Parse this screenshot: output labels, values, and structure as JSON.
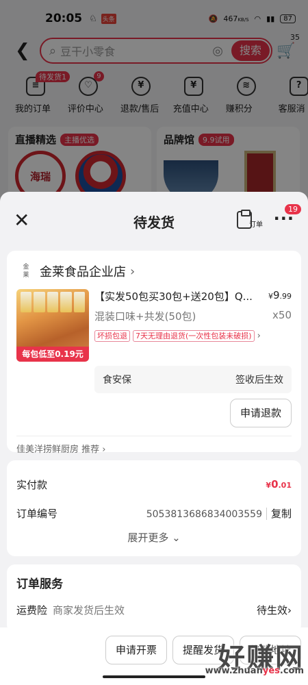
{
  "status_bar": {
    "time": "20:05",
    "net_speed": "467",
    "net_unit": "KB/S",
    "battery": "87",
    "news_icon": "头条"
  },
  "bg": {
    "search_placeholder": "豆干小零食",
    "search_button": "搜索",
    "cart_count": "35",
    "shortcuts": [
      {
        "label": "我的订单",
        "badge_tag": "待发货1",
        "icon": "clipboard-icon"
      },
      {
        "label": "评价中心",
        "badge_num": "9",
        "icon": "chat-heart-icon"
      },
      {
        "label": "退款/售后",
        "icon": "refund-icon"
      },
      {
        "label": "充值中心",
        "icon": "phone-yuan-icon"
      },
      {
        "label": "赚积分",
        "icon": "coins-icon"
      },
      {
        "label": "客服消",
        "icon": "service-icon"
      }
    ],
    "promo_left": {
      "title": "直播精选",
      "tag": "主播优选",
      "logo_text": "海瑞"
    },
    "promo_right": {
      "title": "品牌馆",
      "tag": "9.9试用"
    }
  },
  "sheet": {
    "title": "待发货",
    "order_icon_label": "订单",
    "more_badge": "19",
    "store": {
      "logo_text_1": "金",
      "logo_text_2": "莱",
      "name": "金莱食品企业店"
    },
    "product": {
      "title": "【实发50包买30包+送20包】Q...",
      "price_symbol": "¥",
      "price_int": "9",
      "price_dec": ".99",
      "spec": "混装口味+共发(50包)",
      "qty": "x50",
      "image_caption": "每包低至0.19元",
      "tags": [
        "坏损包退",
        "7天无理由退货(一次性包装未破损)"
      ]
    },
    "guarantee": {
      "name": "食安保",
      "status": "签收后生效"
    },
    "refund_button": "申请退款",
    "recommend": "佳美洋捞鲜厨房 推荐",
    "payment": {
      "paid_label": "实付款",
      "paid_symbol": "¥",
      "paid_int": "0",
      "paid_dec": ".01",
      "order_no_label": "订单编号",
      "order_no": "5053813686834003559",
      "copy": "复制",
      "expand": "展开更多"
    },
    "service": {
      "title": "订单服务",
      "row_name": "运费险",
      "row_desc": "商家发货后生效",
      "row_status": "待生效"
    }
  },
  "bottom_buttons": [
    "申请开票",
    "提醒发货",
    "修改地址"
  ],
  "watermark": {
    "text": "好赚网",
    "url_prefix": "www.zhuan",
    "url_highlight": "yes",
    "url_suffix": ".com"
  }
}
